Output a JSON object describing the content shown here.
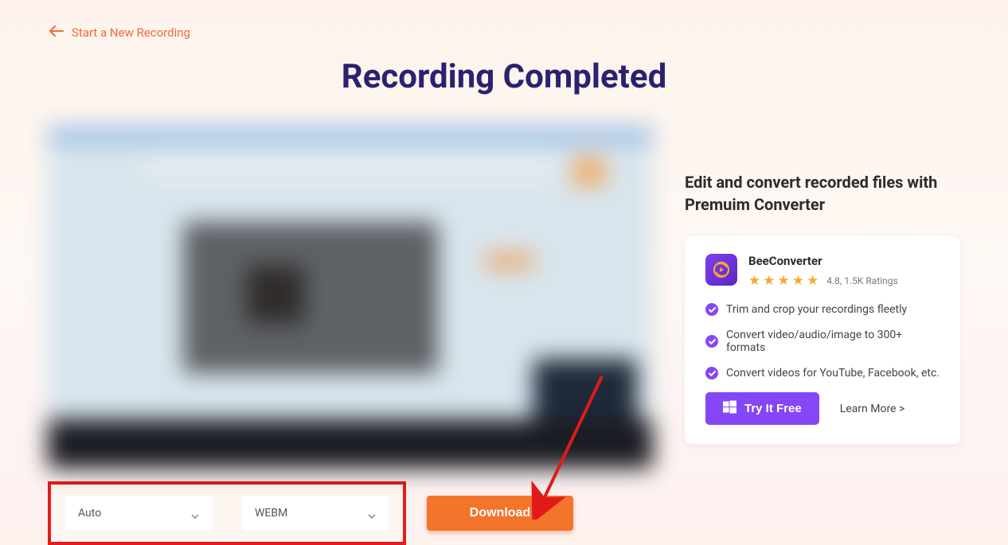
{
  "backLink": "Start a New Recording",
  "title": "Recording Completed",
  "dropdowns": {
    "quality": "Auto",
    "format": "WEBM"
  },
  "downloadLabel": "Download",
  "aside": {
    "title": "Edit and convert recorded files with Premuim Converter",
    "product": {
      "name": "BeeConverter",
      "ratingText": "4.8, 1.5K Ratings"
    },
    "features": [
      "Trim and crop your recordings fleetly",
      "Convert video/audio/image to 300+ formats",
      "Convert videos for YouTube, Facebook, etc."
    ],
    "tryLabel": "Try It Free",
    "learnMore": "Learn More >"
  }
}
